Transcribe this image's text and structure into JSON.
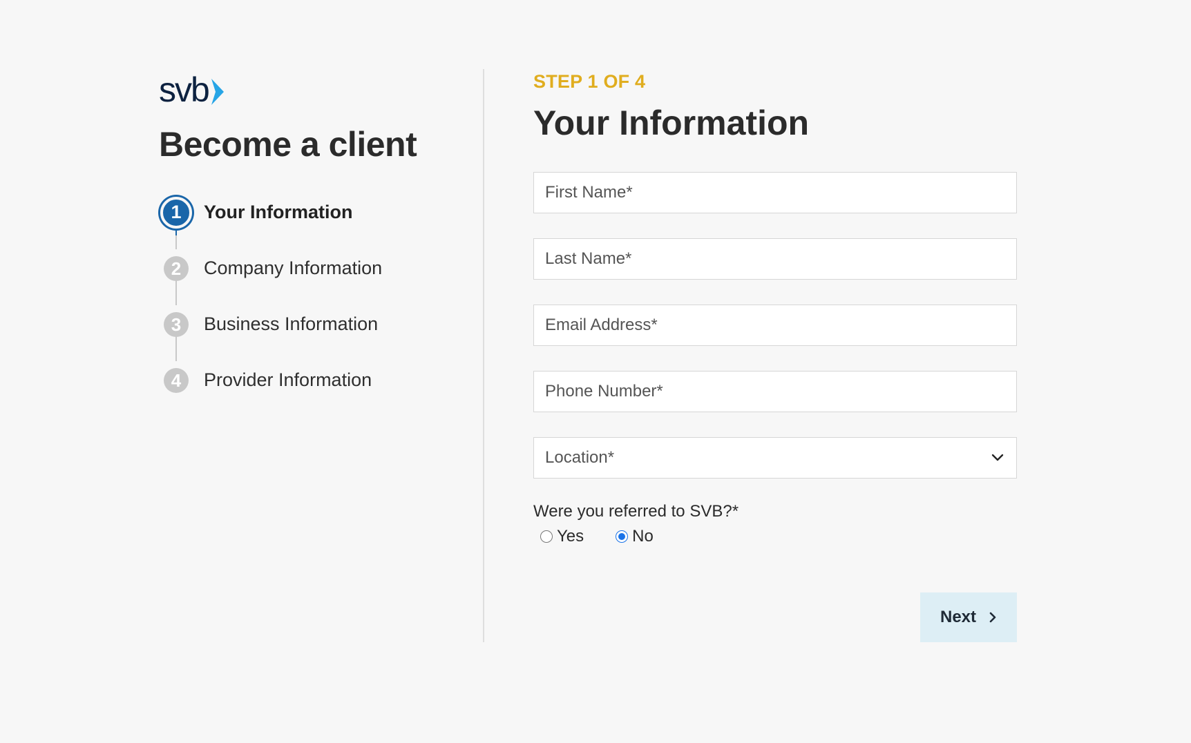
{
  "brand": {
    "logo_text": "svb",
    "chevron_color": "#27a5e6",
    "text_color": "#0d2240"
  },
  "sidebar": {
    "title": "Become a client",
    "steps": [
      {
        "number": "1",
        "label": "Your Information",
        "active": true
      },
      {
        "number": "2",
        "label": "Company Information",
        "active": false
      },
      {
        "number": "3",
        "label": "Business Information",
        "active": false
      },
      {
        "number": "4",
        "label": "Provider Information",
        "active": false
      }
    ]
  },
  "form": {
    "step_indicator": "STEP 1 OF 4",
    "title": "Your Information",
    "fields": {
      "first_name": {
        "placeholder": "First Name*",
        "value": ""
      },
      "last_name": {
        "placeholder": "Last Name*",
        "value": ""
      },
      "email": {
        "placeholder": "Email Address*",
        "value": ""
      },
      "phone": {
        "placeholder": "Phone Number*",
        "value": ""
      },
      "location": {
        "selected": "Location*"
      }
    },
    "referral": {
      "question": "Were you referred to SVB?*",
      "options": [
        {
          "label": "Yes",
          "checked": false
        },
        {
          "label": "No",
          "checked": true
        }
      ]
    },
    "next_label": "Next"
  },
  "colors": {
    "active_step": "#1a66a9",
    "inactive_step": "#c8c8c8",
    "kicker": "#e0ad1f",
    "next_button_bg": "#ddeef5",
    "radio_checked": "#1a73e8"
  }
}
